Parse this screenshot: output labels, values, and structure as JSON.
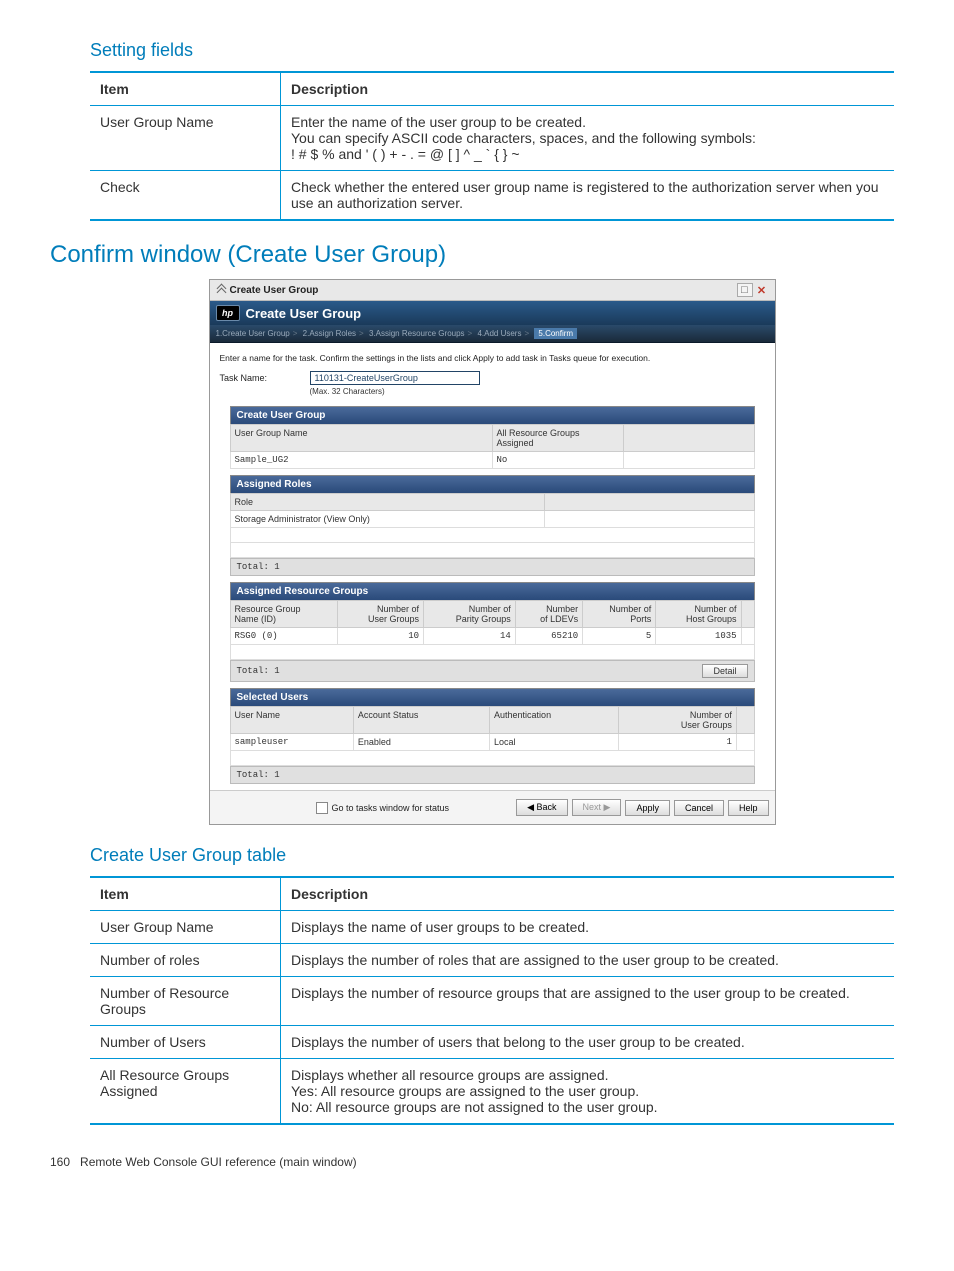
{
  "headings": {
    "setting_fields": "Setting fields",
    "confirm_window": "Confirm window (Create User Group)",
    "create_table": "Create User Group table"
  },
  "table1": {
    "h_item": "Item",
    "h_desc": "Description",
    "rows": [
      {
        "item": "User Group Name",
        "desc": "Enter the name of the user group to be created.\nYou can specify ASCII code characters, spaces, and the following symbols:\n! # $ % and ' ( ) + - . = @ [ ] ^ _ ` { } ~"
      },
      {
        "item": "Check",
        "desc": "Check whether the entered user group name is registered to the authorization server when you use an authorization server."
      }
    ]
  },
  "shot": {
    "titlebar": "Create User Group",
    "bluebar": "Create User Group",
    "bc": {
      "s1": "1.Create User Group",
      "s2": "2.Assign Roles",
      "s3": "3.Assign Resource Groups",
      "s4": "4.Add Users",
      "s5": "5.Confirm"
    },
    "instruction": "Enter a name for the task. Confirm the settings in the lists and click Apply to add task in Tasks queue for execution.",
    "task_label": "Task Name:",
    "task_value": "110131-CreateUserGroup",
    "task_sub": "(Max. 32 Characters)",
    "p_create": {
      "title": "Create User Group",
      "h_name": "User Group Name",
      "h_arg": "All Resource Groups\nAssigned",
      "v_name": "Sample_UG2",
      "v_arg": "No"
    },
    "p_roles": {
      "title": "Assigned Roles",
      "h_role": "Role",
      "v_role": "Storage Administrator (View Only)",
      "total": "Total: 1"
    },
    "p_rg": {
      "title": "Assigned Resource Groups",
      "h": [
        "Resource Group\nName (ID)",
        "Number of\nUser Groups",
        "Number of\nParity Groups",
        "Number\nof LDEVs",
        "Number of\nPorts",
        "Number of\nHost Groups"
      ],
      "v": [
        "RSG0 (0)",
        "10",
        "14",
        "65210",
        "5",
        "1035"
      ],
      "total": "Total: 1",
      "detail": "Detail"
    },
    "p_users": {
      "title": "Selected Users",
      "h": [
        "User Name",
        "Account Status",
        "Authentication",
        "Number of\nUser Groups"
      ],
      "v": [
        "sampleuser",
        "Enabled",
        "Local",
        "1"
      ],
      "total": "Total: 1"
    },
    "footer": {
      "chk": "Go to tasks window for status",
      "back": "◀ Back",
      "next": "Next ▶",
      "apply": "Apply",
      "cancel": "Cancel",
      "help": "Help"
    }
  },
  "table2": {
    "h_item": "Item",
    "h_desc": "Description",
    "rows": [
      {
        "item": "User Group Name",
        "desc": "Displays the name of user groups to be created."
      },
      {
        "item": "Number of roles",
        "desc": "Displays the number of roles that are assigned to the user group to be created."
      },
      {
        "item": "Number of Resource Groups",
        "desc": "Displays the number of resource groups that are assigned to the user group to be created."
      },
      {
        "item": "Number of Users",
        "desc": "Displays the number of users that belong to the user group to be created."
      },
      {
        "item": "All Resource Groups Assigned",
        "desc": "Displays whether all resource groups are assigned.\nYes: All resource groups are assigned to the user group.\nNo: All resource groups are not assigned to the user group."
      }
    ]
  },
  "page_footer": {
    "num": "160",
    "text": "Remote Web Console GUI reference (main window)"
  }
}
